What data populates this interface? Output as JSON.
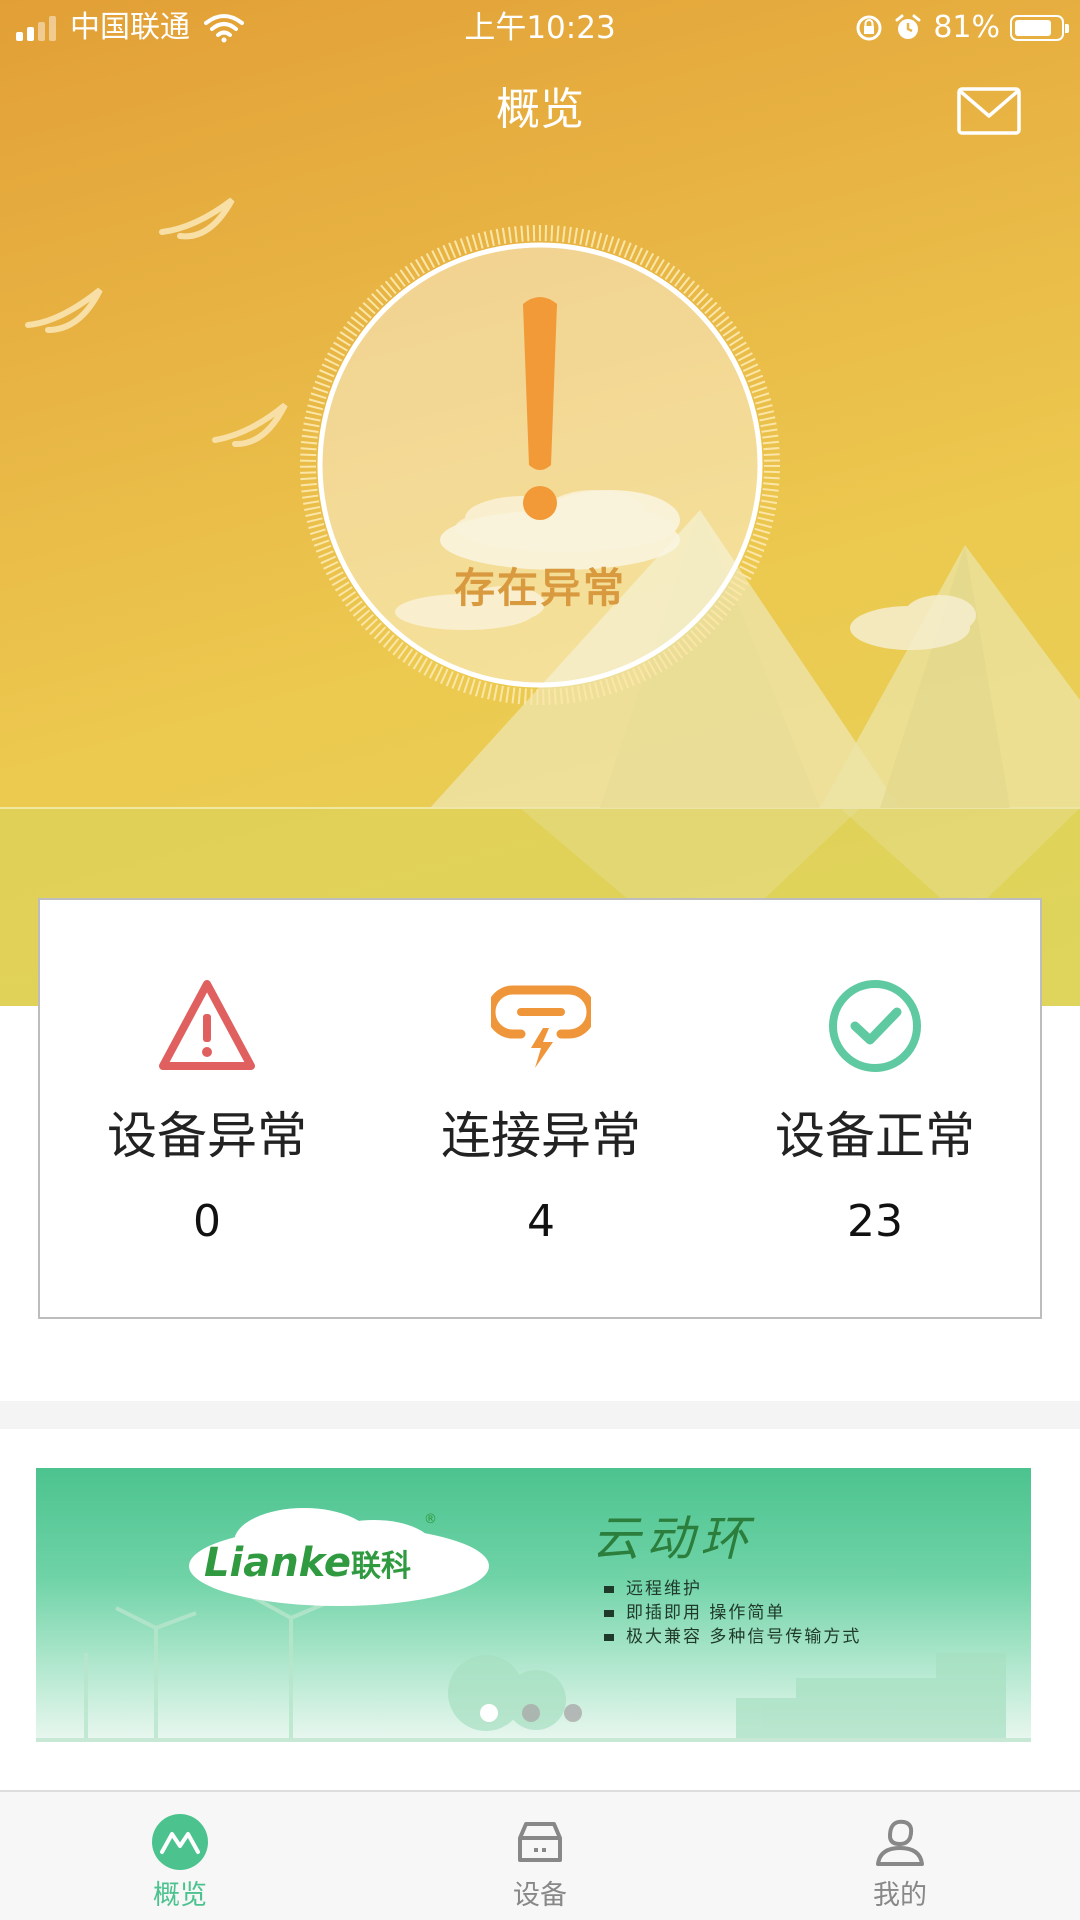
{
  "status_bar": {
    "carrier": "中国联通",
    "time": "上午10:23",
    "battery_percent": "81%",
    "battery_level": 0.81,
    "signal_bars": 2,
    "icons": [
      "signal-icon",
      "wifi-icon",
      "orientation-lock-icon",
      "alarm-icon",
      "battery-icon"
    ]
  },
  "header": {
    "title": "概览",
    "mail_icon": "mail-icon"
  },
  "status": {
    "icon": "exclamation-icon",
    "text": "存在异常",
    "accent_color": "#f29a38"
  },
  "summary": {
    "items": [
      {
        "label": "设备异常",
        "value": "0",
        "icon": "warning-triangle-icon",
        "color": "#e06060"
      },
      {
        "label": "连接异常",
        "value": "4",
        "icon": "link-broken-icon",
        "color": "#f0963a"
      },
      {
        "label": "设备正常",
        "value": "23",
        "icon": "check-circle-icon",
        "color": "#5fc9a2"
      }
    ]
  },
  "banner": {
    "logo_text": "Lianke",
    "logo_cn": "联科",
    "logo_reg": "®",
    "title": "云动环",
    "bullets": [
      "远程维护",
      "即插即用 操作简单",
      "极大兼容 多种信号传输方式"
    ],
    "slide_count": 3,
    "active_slide": 1
  },
  "tabbar": {
    "tabs": [
      {
        "label": "概览",
        "icon": "overview-icon",
        "active": true
      },
      {
        "label": "设备",
        "icon": "device-icon",
        "active": false
      },
      {
        "label": "我的",
        "icon": "profile-icon",
        "active": false
      }
    ],
    "active_color": "#4cc38f",
    "inactive_color": "#888888"
  }
}
